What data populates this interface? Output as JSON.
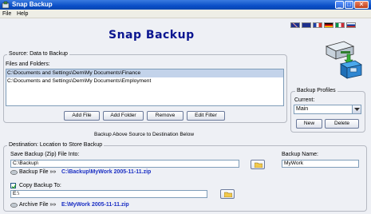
{
  "window": {
    "title": "Snap Backup"
  },
  "menu": {
    "file": "File",
    "help": "Help"
  },
  "header": {
    "app_title": "Snap Backup"
  },
  "languages": [
    "english",
    "australia",
    "france",
    "germany",
    "italy",
    "russia"
  ],
  "source": {
    "group_label": "Source: Data to Backup",
    "list_label": "Files and Folders:",
    "items": [
      "C:\\Documents and Settings\\Dem\\My Documents\\Finance",
      "C:\\Documents and Settings\\Dem\\My Documents\\Employment"
    ],
    "buttons": {
      "add_file": "Add File",
      "add_folder": "Add Folder",
      "remove": "Remove",
      "edit_filter": "Edit Filter"
    }
  },
  "profiles": {
    "group_label": "Backup Profiles",
    "current_label": "Current:",
    "current_value": "Main",
    "new_button": "New",
    "delete_button": "Delete"
  },
  "hint": "Backup Above Source to Destination Below",
  "destination": {
    "group_label": "Destination: Location to Store Backup",
    "save_label": "Save Backup (Zip) File Into:",
    "save_value": "C:\\Backup\\",
    "backup_name_label": "Backup Name:",
    "backup_name_value": "MyWork",
    "backup_file_label": "Backup File »»",
    "backup_file_path": "C:\\Backup\\MyWork 2005-11-11.zip",
    "copy_label": "Copy Backup To:",
    "copy_checked": true,
    "copy_value": "E:\\",
    "archive_file_label": "Archive File »»",
    "archive_file_path": "E:\\MyWork 2005-11-11.zip"
  },
  "colors": {
    "title_blue": "#0a1590",
    "link_blue": "#1b2fc4",
    "titlebar": "#0a4fc8"
  }
}
